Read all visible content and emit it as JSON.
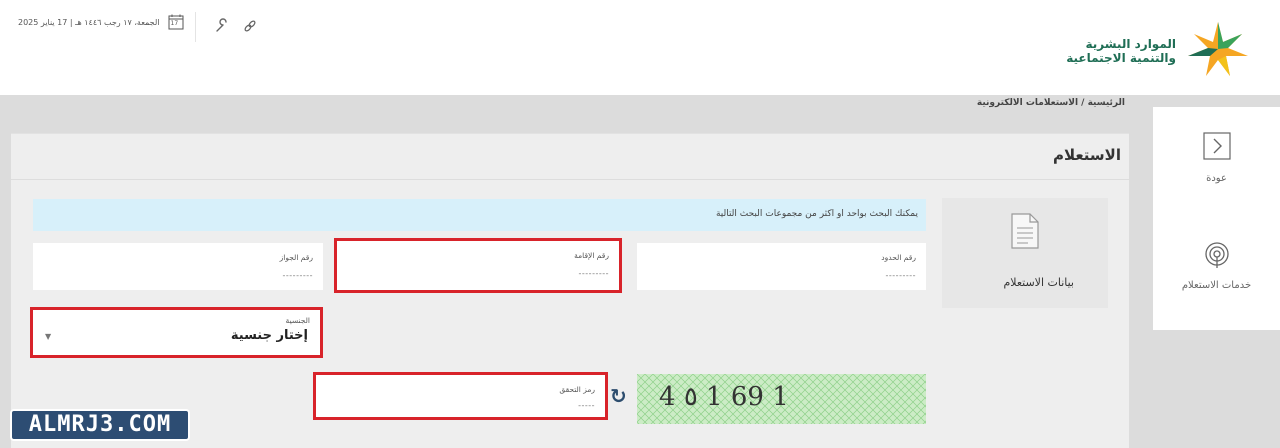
{
  "header": {
    "date_text": "الجمعة، ١٧ رجب ١٤٤٦ هـ | 17 يناير 2025",
    "calendar_day": "17",
    "logo_line1": "الموارد البشرية",
    "logo_line2": "والتنمية الاجتماعية"
  },
  "breadcrumb": "الرئيسية / الاستعلامات الالكترونية",
  "sidebar": {
    "items": [
      {
        "label": "عودة",
        "icon": "chevron-right-icon"
      },
      {
        "label": "خدمات الاستعلام",
        "icon": "broadcast-icon"
      }
    ]
  },
  "main": {
    "title": "الاستعلام",
    "data_card_label": "بيانات الاستعلام",
    "info_message": "يمكنك البحث بواحد او اكثر من مجموعات البحث التالية",
    "fields": {
      "border_number": {
        "label": "رقم الحدود",
        "value": "---------"
      },
      "iqama_number": {
        "label": "رقم الإقامة",
        "value": "---------"
      },
      "passport_number": {
        "label": "رقم الجواز",
        "value": "---------"
      },
      "nationality": {
        "label": "الجنسية",
        "value": "إختار جنسية"
      },
      "captcha_code": {
        "label": "رمز التحقق",
        "value": "-----"
      }
    },
    "captcha_text": "4 ٥ 1 69 1"
  },
  "watermark": "ALMRJ3.COM",
  "colors": {
    "highlight_red": "#d8232a",
    "info_bg": "#d7f0fa",
    "brand_green": "#1f6e55"
  }
}
